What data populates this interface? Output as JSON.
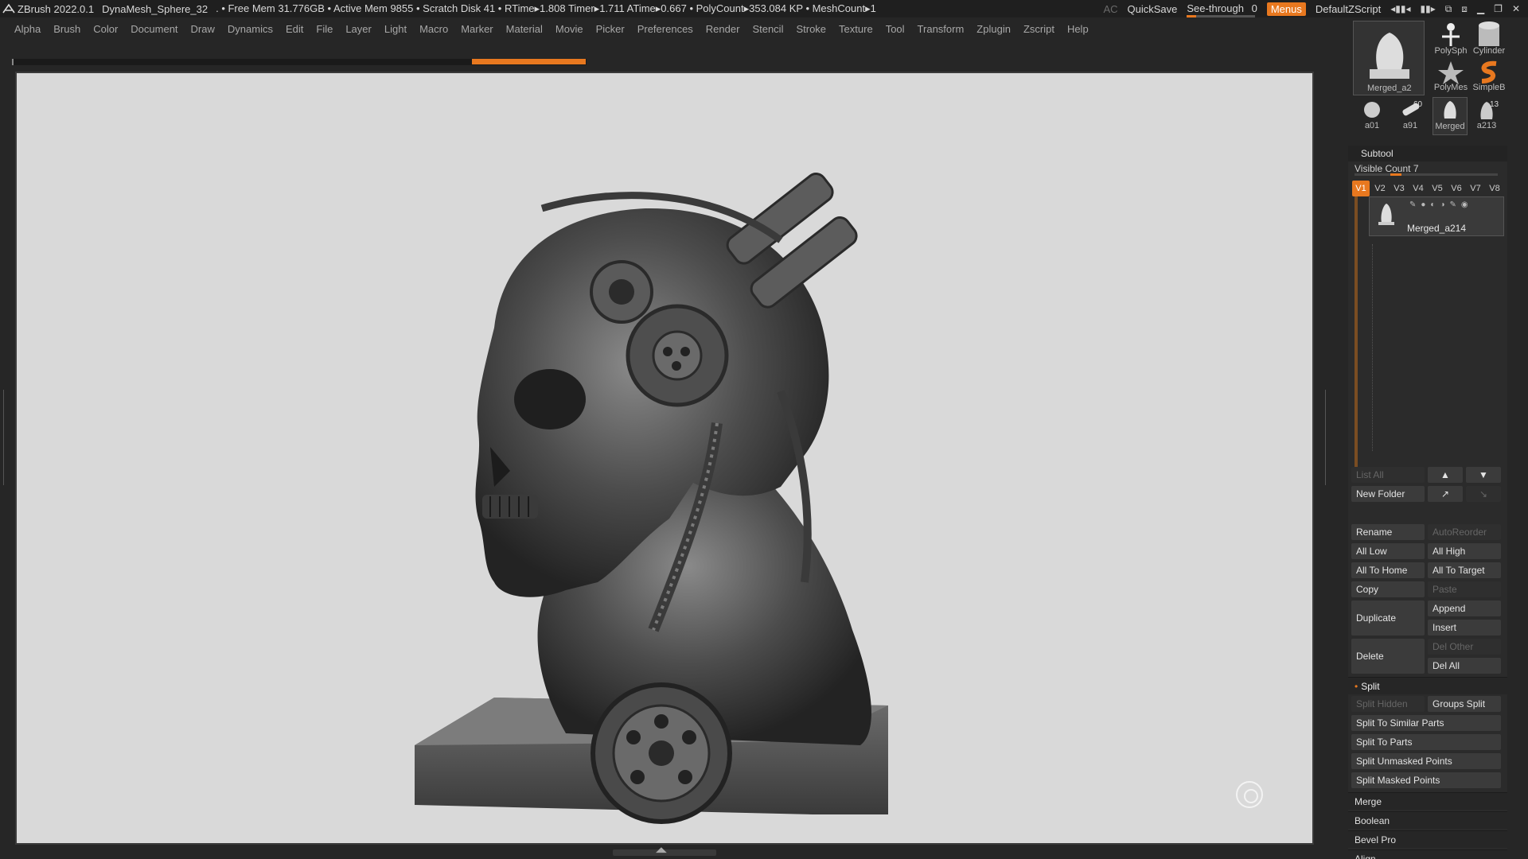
{
  "titlebar": {
    "app": "ZBrush 2022.0.1",
    "document": "DynaMesh_Sphere_32",
    "stats": ". • Free Mem 31.776GB • Active Mem 9855 • Scratch Disk 41 •  RTime▸1.808 Timer▸1.711 ATime▸0.667 • PolyCount▸353.084 KP  • MeshCount▸1",
    "ac": "AC",
    "quicksave": "QuickSave",
    "seethrough_label": "See-through",
    "seethrough_value": "0",
    "menus": "Menus",
    "zscript": "DefaultZScript"
  },
  "menubar": [
    "Alpha",
    "Brush",
    "Color",
    "Document",
    "Draw",
    "Dynamics",
    "Edit",
    "File",
    "Layer",
    "Light",
    "Macro",
    "Marker",
    "Material",
    "Movie",
    "Picker",
    "Preferences",
    "Render",
    "Stencil",
    "Stroke",
    "Texture",
    "Tool",
    "Transform",
    "Zplugin",
    "Zscript",
    "Help"
  ],
  "tools": {
    "current": "Merged_a214",
    "polysphere": "PolySph",
    "cylinder": "Cylinder",
    "polymesh": "PolyMes",
    "simpleb": "SimpleB",
    "a01": "a01",
    "a91": "a91",
    "merged": "Merged",
    "a213": "a213",
    "badge_60": "60",
    "badge_13": "13"
  },
  "subtool": {
    "header": "Subtool",
    "visible_count": "Visible Count 7",
    "vtabs": [
      "V1",
      "V2",
      "V3",
      "V4",
      "V5",
      "V6",
      "V7",
      "V8"
    ],
    "active_item": "Merged_a214",
    "buttons": {
      "list_all": "List All",
      "new_folder": "New Folder",
      "rename": "Rename",
      "auto_reorder": "AutoReorder",
      "all_low": "All Low",
      "all_high": "All High",
      "all_to_home": "All To Home",
      "all_to_target": "All To Target",
      "copy": "Copy",
      "paste": "Paste",
      "duplicate": "Duplicate",
      "append": "Append",
      "insert": "Insert",
      "delete": "Delete",
      "del_other": "Del Other",
      "del_all": "Del All"
    },
    "split": {
      "header": "Split",
      "split_hidden": "Split Hidden",
      "groups_split": "Groups Split",
      "split_similar": "Split To Similar Parts",
      "split_parts": "Split To Parts",
      "split_unmasked": "Split Unmasked Points",
      "split_masked": "Split Masked Points"
    },
    "sections": [
      "Merge",
      "Boolean",
      "Bevel Pro",
      "Align"
    ]
  },
  "colors": {
    "accent": "#e8781f",
    "canvas": "#d9d9d9",
    "panel": "#2b2b2b"
  }
}
